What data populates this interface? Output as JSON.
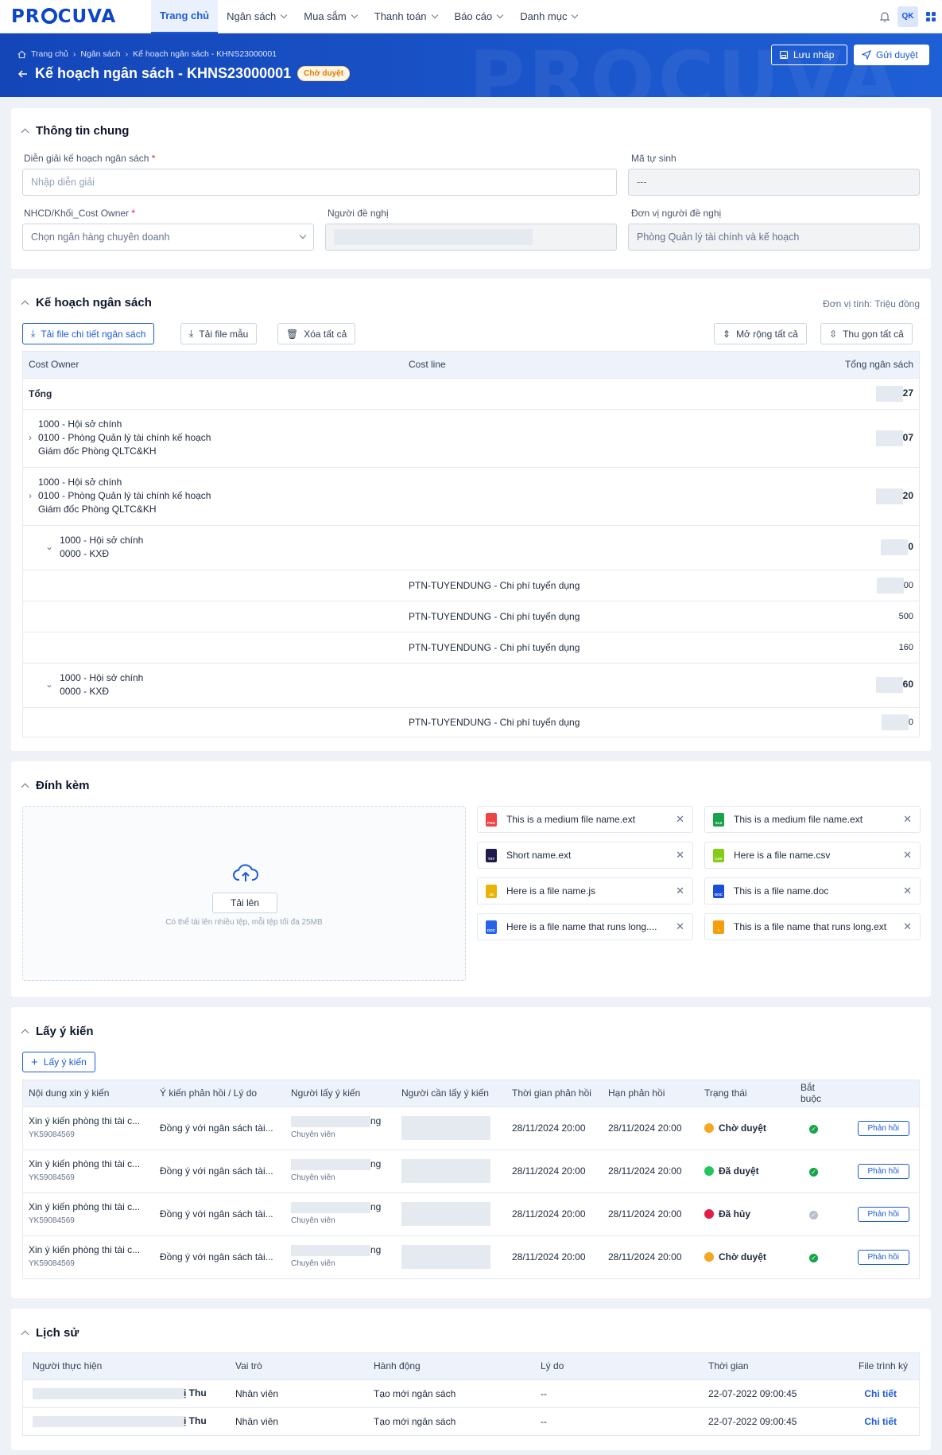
{
  "nav": {
    "logo": "PROCUVA",
    "items": [
      {
        "label": "Trang chủ"
      },
      {
        "label": "Ngân sách"
      },
      {
        "label": "Mua sắm"
      },
      {
        "label": "Thanh toán"
      },
      {
        "label": "Báo cáo"
      },
      {
        "label": "Danh mục"
      }
    ],
    "avatar": "QK"
  },
  "header": {
    "breadcrumb": [
      "Trang chủ",
      "Ngân sách",
      "Kế hoạch ngân sách - KHNS23000001"
    ],
    "title": "Kế hoạch ngân sách - KHNS23000001",
    "status": "Chờ duyệt",
    "save_draft": "Lưu nháp",
    "submit": "Gửi duyệt",
    "watermark": "PROCUVA"
  },
  "general": {
    "title": "Thông tin chung",
    "desc_label": "Diễn giải kế hoạch ngân sách",
    "desc_placeholder": "Nhập diễn giải",
    "code_label": "Mã tự sinh",
    "code_value": "---",
    "owner_label": "NHCD/Khối_Cost Owner",
    "owner_placeholder": "Chọn ngân hàng chuyên doanh",
    "proposer_label": "Người đề nghị",
    "unit_label": "Đơn vị người đề nghị",
    "unit_value": "Phòng Quản lý tài chính và kế hoạch"
  },
  "plan": {
    "title": "Kế hoạch ngân sách",
    "unit_note": "Đơn vị tính: Triệu đồng",
    "btn_upload": "Tải file chi tiết ngân sách",
    "btn_template": "Tải file mẫu",
    "btn_clear": "Xóa tất cả",
    "btn_expand": "Mở rộng tất cả",
    "btn_collapse": "Thu gọn tất cả",
    "col_owner": "Cost Owner",
    "col_line": "Cost line",
    "col_total": "Tổng ngân sách",
    "total_label": "Tổng",
    "total_tail": "27",
    "rows": [
      {
        "l1": "1000 - Hội sở chính",
        "l2": "0100 - Phòng Quản lý tài chính kế hoạch",
        "l3": "Giám đốc Phòng QLTC&KH",
        "tail": "07"
      },
      {
        "l1": "1000 - Hội sở chính",
        "l2": "0100 - Phòng Quản lý tài chính kế hoạch",
        "l3": "Giám đốc Phòng QLTC&KH",
        "tail": "20"
      },
      {
        "l1": "1000 - Hội sở chính",
        "l2": "0000 - KXĐ",
        "tail": "0"
      },
      {
        "line": "PTN-TUYENDUNG - Chi phí tuyển dụng",
        "tail": "00"
      },
      {
        "line": "PTN-TUYENDUNG - Chi phí tuyển dụng",
        "value": "500"
      },
      {
        "line": "PTN-TUYENDUNG - Chi phí tuyển dụng",
        "value": "160"
      },
      {
        "l1": "1000 - Hội sở chính",
        "l2": "0000 - KXĐ",
        "tail": "60"
      },
      {
        "line": "PTN-TUYENDUNG - Chi phí tuyển dụng",
        "tail": "0"
      }
    ]
  },
  "attach": {
    "title": "Đính kèm",
    "upload_btn": "Tải lên",
    "upload_hint": "Có thể tải lên nhiều tệp, mỗi tệp tối đa 25MB",
    "files": [
      {
        "name": "This is a medium file name.ext",
        "type": "PNG",
        "color": "#ef4444"
      },
      {
        "name": "This is a medium file name.ext",
        "type": "XLS",
        "color": "#16a34a"
      },
      {
        "name": "Short name.ext",
        "type": "TXT",
        "color": "#1e1b4b"
      },
      {
        "name": "Here is a file name.csv",
        "type": "CSV",
        "color": "#84cc16"
      },
      {
        "name": "Here is a file name.js",
        "type": "JS",
        "color": "#eab308"
      },
      {
        "name": "This is a file name.doc",
        "type": "DOC",
        "color": "#1d4ed8"
      },
      {
        "name": "Here is a file name that runs long....",
        "type": "DOC",
        "color": "#2563eb"
      },
      {
        "name": "This is a file name that runs long.ext",
        "type": "!",
        "color": "#f59e0b"
      }
    ]
  },
  "opinion": {
    "title": "Lấy ý kiến",
    "add_btn": "Lấy ý kiến",
    "cols": [
      "Nội dung xin ý kiến",
      "Ý kiến phản hồi / Lý do",
      "Người lấy ý kiến",
      "Người cần lấy ý kiến",
      "Thời gian phản hồi",
      "Hạn phản hồi",
      "Trạng thái",
      "Bắt buộc",
      ""
    ],
    "rows": [
      {
        "content": "Xin ý kiến phòng thi tài c...",
        "code": "YK59084569",
        "reply": "Đồng ý với ngân sách tài...",
        "name_tail": "ng",
        "role": "Chuyên viên",
        "time": "28/11/2024 20:00",
        "deadline": "28/11/2024 20:00",
        "status": "Chờ duyệt",
        "status_color": "#f5a623",
        "req_color": "#16a34a",
        "action": "Phản hồi"
      },
      {
        "content": "Xin ý kiến phòng thi tài c...",
        "code": "YK59084569",
        "reply": "Đồng ý với ngân sách tài...",
        "name_tail": "ng",
        "role": "Chuyên viên",
        "time": "28/11/2024 20:00",
        "deadline": "28/11/2024 20:00",
        "status": "Đã duyệt",
        "status_color": "#22c55e",
        "req_color": "#16a34a",
        "action": "Phản hồi"
      },
      {
        "content": "Xin ý kiến phòng thi tài c...",
        "code": "YK59084569",
        "reply": "Đồng ý với ngân sách tài...",
        "name_tail": "ng",
        "role": "Chuyên viên",
        "time": "28/11/2024 20:00",
        "deadline": "28/11/2024 20:00",
        "status": "Đã hủy",
        "status_color": "#e11d48",
        "req_color": "#b8c0cc",
        "action": "Phản hồi"
      },
      {
        "content": "Xin ý kiến phòng thi tài c...",
        "code": "YK59084569",
        "reply": "Đồng ý với ngân sách tài...",
        "name_tail": "ng",
        "role": "Chuyên viên",
        "time": "28/11/2024 20:00",
        "deadline": "28/11/2024 20:00",
        "status": "Chờ duyệt",
        "status_color": "#f5a623",
        "req_color": "#16a34a",
        "action": "Phản hồi"
      }
    ]
  },
  "history": {
    "title": "Lịch sử",
    "cols": [
      "Người thực hiện",
      "Vai trò",
      "Hành động",
      "Lý do",
      "Thời gian",
      "File trình ký"
    ],
    "rows": [
      {
        "actor_tail": "ị Thu",
        "role": "Nhân viên",
        "action": "Tạo mới ngân sách",
        "reason": "--",
        "time": "22-07-2022 09:00:45",
        "file": "Chi tiết"
      },
      {
        "actor_tail": "ị Thu",
        "role": "Nhân viên",
        "action": "Tạo mới ngân sách",
        "reason": "--",
        "time": "22-07-2022 09:00:45",
        "file": "Chi tiết"
      }
    ]
  }
}
